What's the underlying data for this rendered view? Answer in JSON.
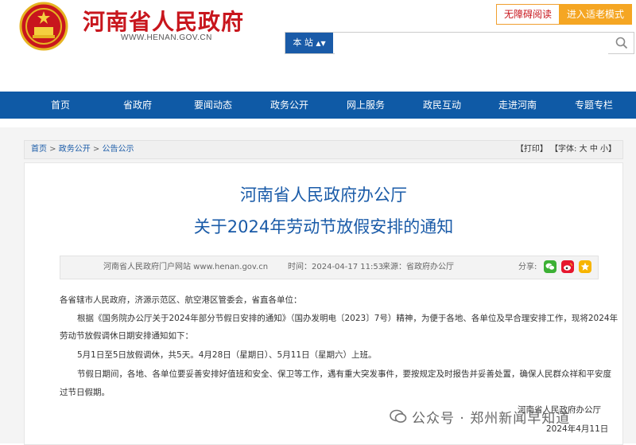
{
  "header": {
    "site_title": "河南省人民政府",
    "site_url": "WWW.HENAN.GOV.CN",
    "accessibility_label": "无障碍阅读",
    "elderly_mode_label": "进入适老模式",
    "search": {
      "scope": "本 站",
      "placeholder": ""
    }
  },
  "nav": [
    "首页",
    "省政府",
    "要闻动态",
    "政务公开",
    "网上服务",
    "政民互动",
    "走进河南",
    "专题专栏"
  ],
  "breadcrumb": {
    "items": [
      "首页",
      "政务公开",
      "公告公示"
    ],
    "sep": " > "
  },
  "tools": {
    "print": "【打印】",
    "font_label": "【字体:",
    "sizes": [
      "大",
      "中",
      "小"
    ],
    "close": "】"
  },
  "article": {
    "title_line1": "河南省人民政府办公厅",
    "title_line2": "关于2024年劳动节放假安排的通知",
    "meta": {
      "source_site": "河南省人民政府门户网站 www.henan.gov.cn",
      "time": "时间：2024-04-17 11:53",
      "origin": "来源：省政府办公厅",
      "share_label": "分享:"
    },
    "body": [
      "各省辖市人民政府，济源示范区、航空港区管委会，省直各单位：",
      "根据《国务院办公厅关于2024年部分节假日安排的通知》（国办发明电〔2023〕7号）精神，为便于各地、各单位及早合理安排工作，现将2024年",
      "劳动节放假调休日期安排通知如下：",
      "5月1日至5日放假调休，共5天。4月28日（星期日）、5月11日（星期六）上班。",
      "节假日期间，各地、各单位要妥善安排好值班和安全、保卫等工作，遇有重大突发事件，要按规定及时报告并妥善处置，确保人民群众祥和平安度",
      "过节日假期。"
    ],
    "signature": "河南省人民政府办公厅",
    "date": "2024年4月11日"
  },
  "watermark": {
    "text": "公众号 · 郑州新闻早知道"
  },
  "colors": {
    "brand_red": "#c8161d",
    "nav_blue": "#0f5aa6",
    "accent_orange": "#f5a623",
    "title_blue": "#1a5ba8"
  },
  "icons": [
    "national-emblem-icon",
    "search-icon",
    "wechat-icon",
    "weibo-icon",
    "star-icon"
  ]
}
